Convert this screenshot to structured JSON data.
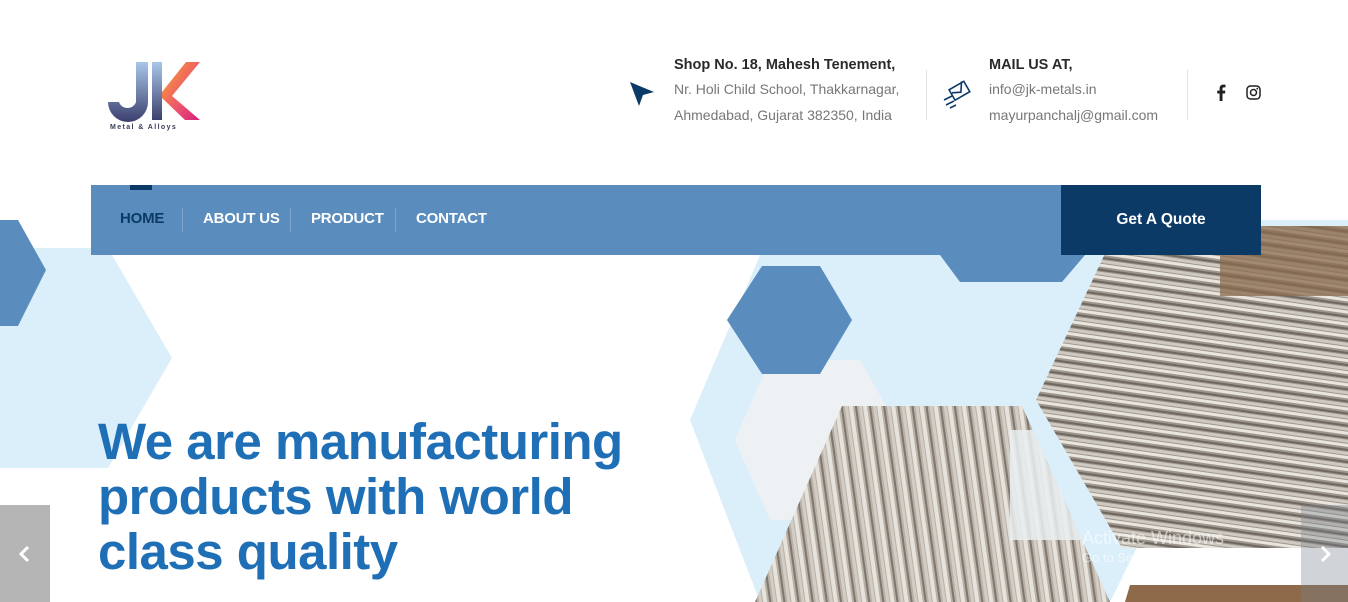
{
  "brand": {
    "logo_letters": "JK",
    "logo_subtitle": "Metal & Alloys"
  },
  "address": {
    "title": "Shop No. 18, Mahesh Tenement,",
    "line1": "Nr. Holi Child School, Thakkarnagar,",
    "line2": "Ahmedabad, Gujarat 382350, India"
  },
  "mail": {
    "title": "MAIL US AT,",
    "email1": "info@jk-metals.in",
    "email2": "mayurpanchalj@gmail.com"
  },
  "social": [
    "facebook-icon",
    "instagram-icon"
  ],
  "nav": {
    "items": [
      {
        "label": "HOME",
        "active": true
      },
      {
        "label": "ABOUT US",
        "active": false
      },
      {
        "label": "PRODUCT",
        "active": false
      },
      {
        "label": "CONTACT",
        "active": false
      }
    ],
    "quote_label": "Get A Quote"
  },
  "hero": {
    "headline_line1": "We are manufacturing",
    "headline_line2": "products with world",
    "headline_line3": "class quality"
  },
  "watermark": {
    "line1": "Activate Windows",
    "line2": "Go to Settings to activate Windows."
  },
  "colors": {
    "nav_bg": "#5a8dbd",
    "nav_dark": "#0b3a66",
    "headline": "#1f6fb6",
    "hex_light": "#dbeffb",
    "hex_mid": "#5a8dbd"
  }
}
